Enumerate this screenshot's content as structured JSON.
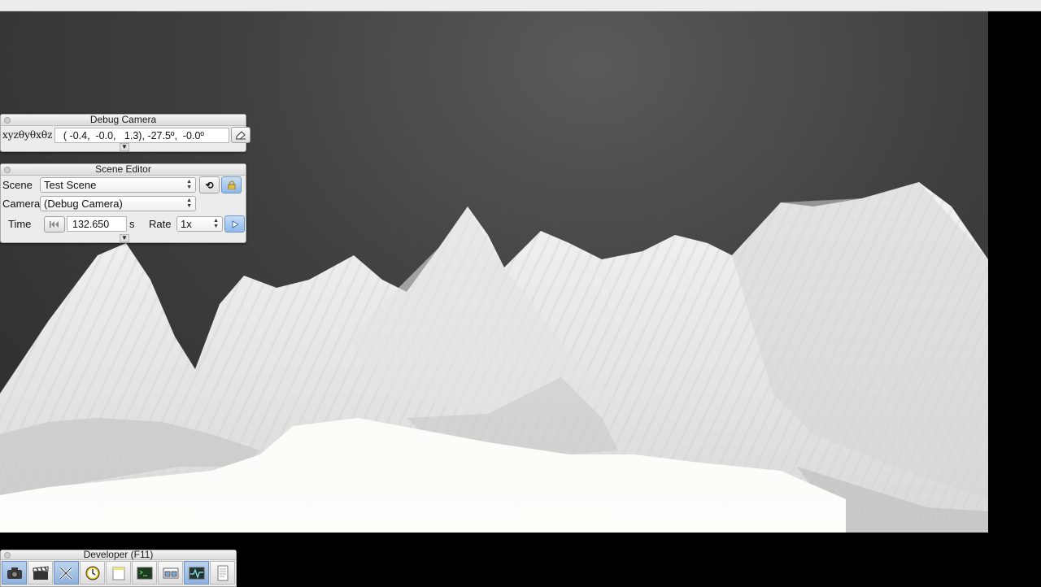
{
  "debug_camera": {
    "title": "Debug Camera",
    "coords_label": "xyzθyθxθz",
    "coords_value": " ( -0.4,  -0.0,   1.3), -27.5º,  -0.0º",
    "copy_icon": "clipboard-icon",
    "expand_icon": "chevron-down-icon"
  },
  "scene_editor": {
    "title": "Scene Editor",
    "scene_label": "Scene",
    "scene_value": "Test Scene",
    "reload_icon": "reload-icon",
    "lock_icon": "lock-icon",
    "camera_label": "Camera",
    "camera_value": "(Debug Camera)",
    "time_label": "Time",
    "rewind_icon": "rewind-icon",
    "time_value": "132.650",
    "time_unit": "s",
    "rate_label": "Rate",
    "rate_value": "1x",
    "play_icon": "play-icon",
    "expand_icon": "chevron-down-icon"
  },
  "developer": {
    "title": "Developer (F11)",
    "tools": [
      {
        "icon": "camera-icon",
        "active": true
      },
      {
        "icon": "clapperboard-icon",
        "active": false
      },
      {
        "icon": "wrench-icon",
        "active": true
      },
      {
        "icon": "clock-icon",
        "active": false
      },
      {
        "icon": "note-icon",
        "active": false
      },
      {
        "icon": "terminal-icon",
        "active": false
      },
      {
        "icon": "windows-icon",
        "active": false
      },
      {
        "icon": "profiler-icon",
        "active": true
      },
      {
        "icon": "document-icon",
        "active": false
      }
    ]
  },
  "colors": {
    "background": "#3d3d3d",
    "terrain": "#ededed",
    "accent": "#8fb8e6"
  }
}
